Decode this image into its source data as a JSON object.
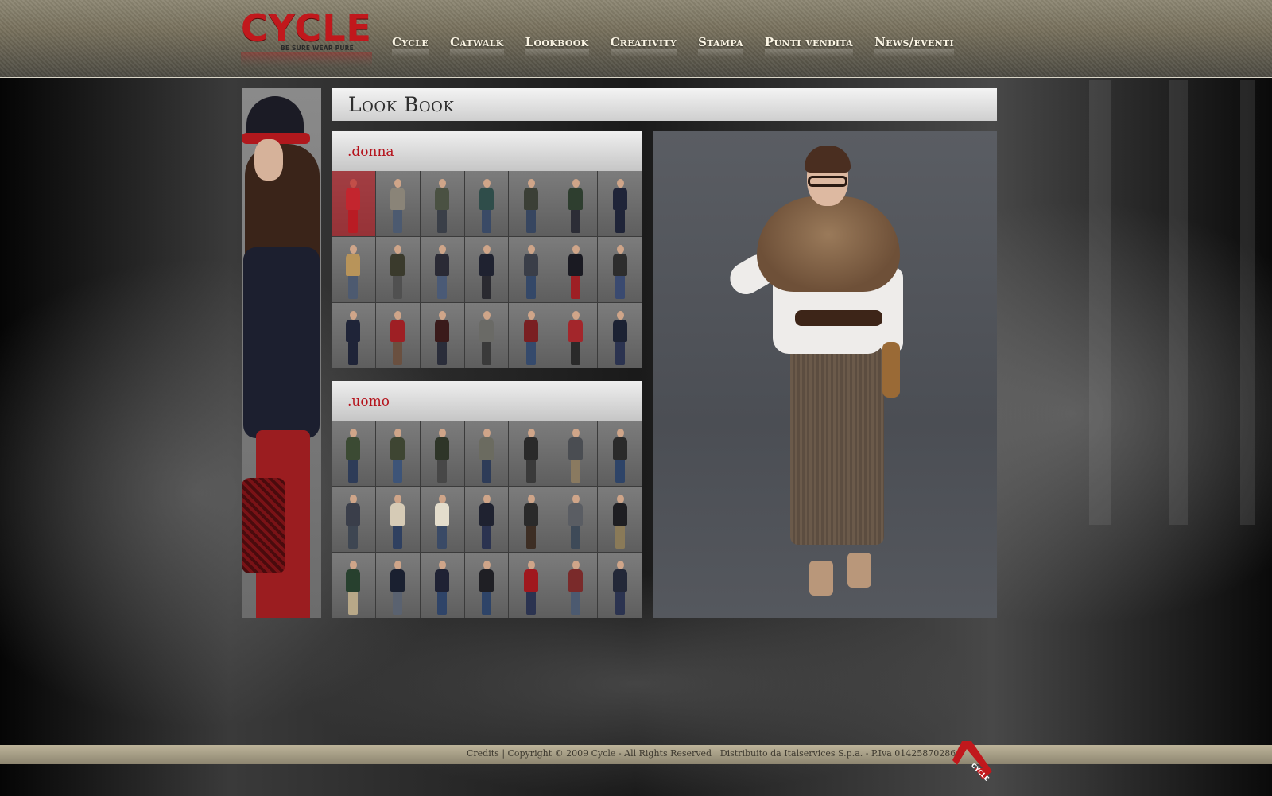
{
  "brand": {
    "logo_text": "CYCLE",
    "logo_tagline": "BE SURE WEAR PURE",
    "accent_color": "#c1181c"
  },
  "nav": {
    "items": [
      {
        "label": "Cycle"
      },
      {
        "label": "Catwalk"
      },
      {
        "label": "Lookbook"
      },
      {
        "label": "Creativity"
      },
      {
        "label": "Stampa"
      },
      {
        "label": "Punti vendita"
      },
      {
        "label": "News/eventi"
      }
    ]
  },
  "page": {
    "title": "Look Book"
  },
  "sections": {
    "donna": {
      "label": ".donna",
      "thumbs": [
        {
          "top": "#d23a44",
          "legs": "#b7242c",
          "active": true
        },
        {
          "top": "#8a8478",
          "legs": "#4c5a70"
        },
        {
          "top": "#4a5142",
          "legs": "#3a3f48"
        },
        {
          "top": "#2f4d4a",
          "legs": "#3a4a66"
        },
        {
          "top": "#3b3f36",
          "legs": "#374660"
        },
        {
          "top": "#2e3e2f",
          "legs": "#2c2d36"
        },
        {
          "top": "#1f2438",
          "legs": "#1f2438"
        },
        {
          "top": "#b8945a",
          "legs": "#4d5a70"
        },
        {
          "top": "#3a3a2c",
          "legs": "#505050"
        },
        {
          "top": "#2a2a35",
          "legs": "#4a5a76"
        },
        {
          "top": "#1f2230",
          "legs": "#2a2a30"
        },
        {
          "top": "#3a3e48",
          "legs": "#344868"
        },
        {
          "top": "#1a1a22",
          "legs": "#9e1f24"
        },
        {
          "top": "#2d2d2d",
          "legs": "#3a4a70"
        },
        {
          "top": "#1f2438",
          "legs": "#1f2438"
        },
        {
          "top": "#9e1f24",
          "legs": "#6a5040"
        },
        {
          "top": "#3a1a1a",
          "legs": "#2a2d3a"
        },
        {
          "top": "#6a6a66",
          "legs": "#3a3a3a"
        },
        {
          "top": "#7a1f22",
          "legs": "#354a6c"
        },
        {
          "top": "#a3262b",
          "legs": "#2a2a2a"
        },
        {
          "top": "#1c2233",
          "legs": "#2b3350"
        }
      ]
    },
    "uomo": {
      "label": ".uomo",
      "thumbs": [
        {
          "top": "#3b4a33",
          "legs": "#2e3c58"
        },
        {
          "top": "#3e4532",
          "legs": "#3d5478"
        },
        {
          "top": "#2e3528",
          "legs": "#474747"
        },
        {
          "top": "#6b6b60",
          "legs": "#2e3c58"
        },
        {
          "top": "#2a2a2a",
          "legs": "#3a3a3a"
        },
        {
          "top": "#4a4d52",
          "legs": "#8a7a60"
        },
        {
          "top": "#2a2a2a",
          "legs": "#2e4468"
        },
        {
          "top": "#3a3e4a",
          "legs": "#3e4652"
        },
        {
          "top": "#d6cbb6",
          "legs": "#2f4060"
        },
        {
          "top": "#e4ddcc",
          "legs": "#3a4a66"
        },
        {
          "top": "#1f2230",
          "legs": "#2b3350"
        },
        {
          "top": "#2a2a2a",
          "legs": "#3d2e24"
        },
        {
          "top": "#5a5d63",
          "legs": "#3e4a58"
        },
        {
          "top": "#1e1e22",
          "legs": "#8a7a58"
        },
        {
          "top": "#27402e",
          "legs": "#b8a888"
        },
        {
          "top": "#1a2030",
          "legs": "#5a6270"
        },
        {
          "top": "#1f2234",
          "legs": "#2f4468"
        },
        {
          "top": "#1f1f24",
          "legs": "#2e4468"
        },
        {
          "top": "#a0181e",
          "legs": "#2b3350"
        },
        {
          "top": "#7a2a2a",
          "legs": "#4c5a70"
        },
        {
          "top": "#232838",
          "legs": "#2b3350"
        }
      ]
    }
  },
  "footer": {
    "credits": "Credits",
    "copyright": "| Copyright © 2009 Cycle - All Rights Reserved | Distribuito da Italservices S.p.a. - P.Iva 01425870286"
  }
}
